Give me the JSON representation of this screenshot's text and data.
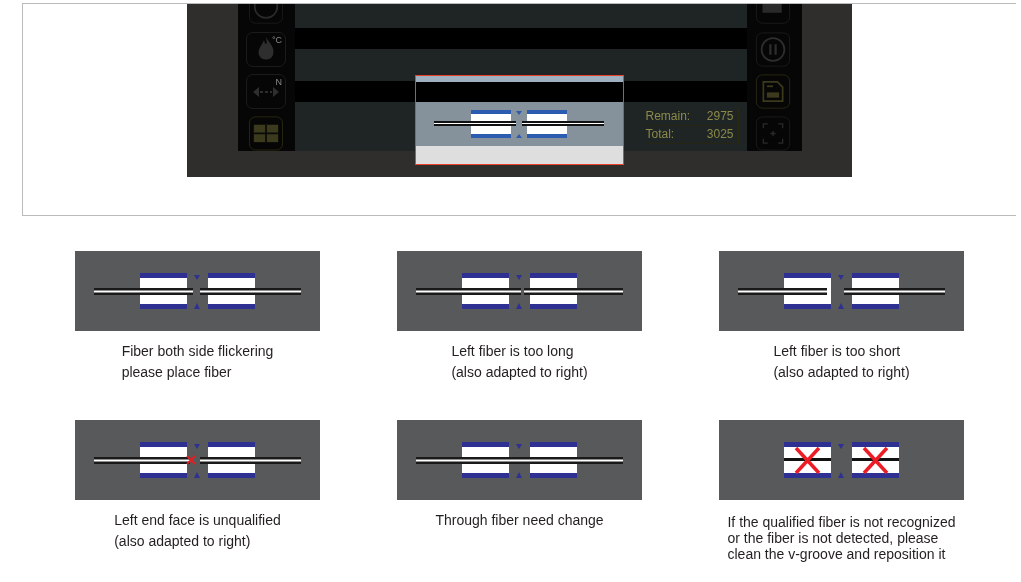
{
  "device_screen": {
    "heat_icon_label": "°C",
    "move_icon_label": "N",
    "counters": [
      {
        "label": "Remain:",
        "value": "2975"
      },
      {
        "label": "Total:",
        "value": "3025"
      }
    ]
  },
  "examples": [
    {
      "kind": "both-flicker",
      "caption": "Fiber  both  side  flickering\nplease  place  fiber"
    },
    {
      "kind": "left-long",
      "caption": "Left fiber is too long\n(also adapted to right)"
    },
    {
      "kind": "left-short",
      "caption": "Left fiber is too short\n(also adapted to right)"
    },
    {
      "kind": "left-end-bad",
      "caption": "Left end face is unqualified\n(also adapted to right)"
    },
    {
      "kind": "through",
      "caption": "Through  fiber  need  change"
    },
    {
      "kind": "not-detected",
      "caption": "If the qualified fiber is not recognized\nor the fiber is not detected, please\nclean the v-groove and reposition it"
    }
  ]
}
